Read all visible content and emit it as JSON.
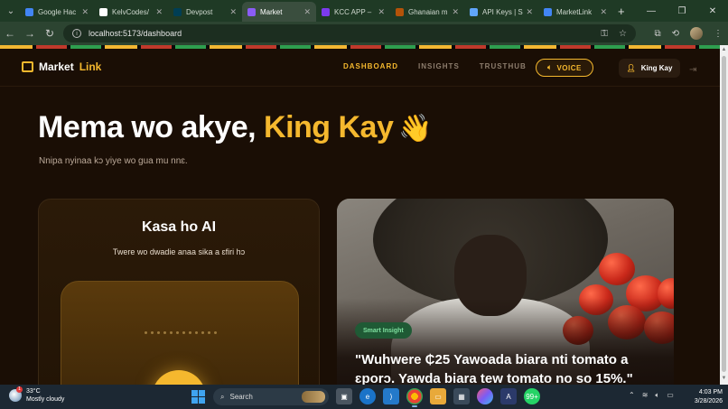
{
  "browser": {
    "tabs": [
      {
        "title": "Google Hac",
        "color": "#4285f4",
        "active": false
      },
      {
        "title": "KelvCodes/",
        "color": "#ffffff",
        "active": false
      },
      {
        "title": "Devpost",
        "color": "#003e54",
        "active": false
      },
      {
        "title": "Market",
        "color": "#8b5cf6",
        "active": true
      },
      {
        "title": "KCC APP –",
        "color": "#7c3aed",
        "active": false
      },
      {
        "title": "Ghanaian m",
        "color": "#b45309",
        "active": false
      },
      {
        "title": "API Keys | S",
        "color": "#60a5fa",
        "active": false
      },
      {
        "title": "MarketLink",
        "color": "#4285f4",
        "active": false
      }
    ],
    "url": "localhost:5173/dashboard"
  },
  "app": {
    "brand_part1": "Market",
    "brand_part2": "Link",
    "nav": [
      {
        "label": "DASHBOARD",
        "active": true
      },
      {
        "label": "INSIGHTS",
        "active": false
      },
      {
        "label": "TRUSTHUB",
        "active": false
      }
    ],
    "voice_label": "VOICE",
    "user_name": "King Kay"
  },
  "hero": {
    "greeting": "Mema wo akye, ",
    "name": "King Kay",
    "wave": "👋",
    "subtitle": "Nnipa nyinaa kɔ yiye wo gua mu nnɛ."
  },
  "ai_card": {
    "title": "Kasa ho AI",
    "subtitle": "Twere wo dwadie anaa sika a ɛfiri hɔ"
  },
  "insight_card": {
    "badge": "Smart Insight",
    "quote_line1": "\"Wuhwere ₵25 Yawoada biara nti tomato a",
    "quote_line2": "ɛporɔ. Yawda biara tew tomato no so 15%.\""
  },
  "taskbar": {
    "temp": "33°C",
    "weather": "Mostly cloudy",
    "search": "Search",
    "badge_count": "99+",
    "time": "4:03 PM",
    "date": "3/28/2026"
  },
  "colors": {
    "accent": "#f5b82e",
    "page_bg": "#1a0e05",
    "insight_green": "#1f5a35"
  }
}
